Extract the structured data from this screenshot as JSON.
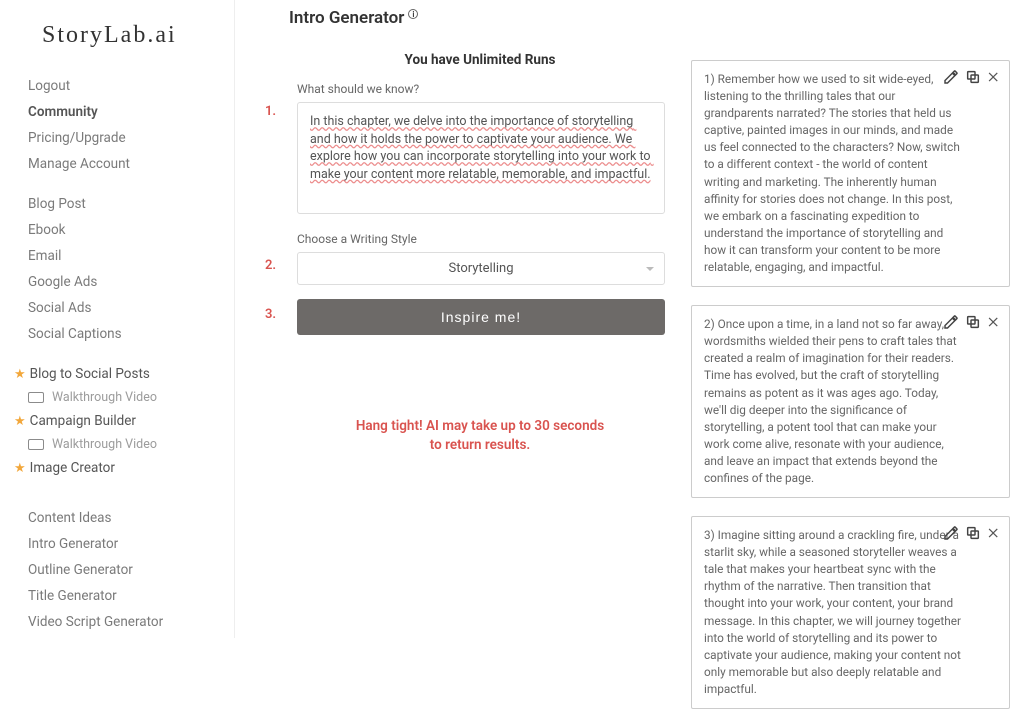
{
  "brand": "StoryLab.ai",
  "sidebar": {
    "account": [
      "Logout",
      "Community",
      "Pricing/Upgrade",
      "Manage Account"
    ],
    "tools1": [
      "Blog Post",
      "Ebook",
      "Email",
      "Google Ads",
      "Social Ads",
      "Social Captions"
    ],
    "featured": [
      {
        "label": "Blog to Social Posts",
        "sub": "Walkthrough Video"
      },
      {
        "label": "Campaign Builder",
        "sub": "Walkthrough Video"
      },
      {
        "label": "Image Creator"
      }
    ],
    "tools2": [
      "Content Ideas",
      "Intro Generator",
      "Outline Generator",
      "Title Generator",
      "Video Script Generator"
    ]
  },
  "page": {
    "title": "Intro Generator",
    "runs_label": "You have Unlimited Runs",
    "steps": [
      "1.",
      "2.",
      "3."
    ],
    "field1_label": "What should we know?",
    "field1_value": "In this chapter, we delve into the importance of storytelling and how it holds the power to captivate your audience. We explore how you can incorporate storytelling into your work to make your content more relatable, memorable, and impactful.",
    "field2_label": "Choose a Writing Style",
    "field2_value": "Storytelling",
    "button_label": "Inspire me!",
    "wait_line1": "Hang tight! AI may take up to 30 seconds",
    "wait_line2": "to return results."
  },
  "results": [
    "1) Remember how we used to sit wide-eyed, listening to the thrilling tales that our grandparents narrated? The stories that held us captive, painted images in our minds, and made us feel connected to the characters? Now, switch to a different context - the world of content writing and marketing. The inherently human affinity for stories does not change. In this post, we embark on a fascinating expedition to understand the importance of storytelling and how it can transform your content to be more relatable, engaging, and impactful.",
    "2) Once upon a time, in a land not so far away, wordsmiths wielded their pens to craft tales that created a realm of imagination for their readers. Time has evolved, but the craft of storytelling remains as potent as it was ages ago. Today, we'll dig deeper into the significance of storytelling, a potent tool that can make your work come alive, resonate with your audience, and leave an impact that extends beyond the confines of the page.",
    "3) Imagine sitting around a crackling fire, under a starlit sky, while a seasoned storyteller weaves a tale that makes your heartbeat sync with the rhythm of the narrative. Then transition that thought into your work, your content, your brand message. In this chapter, we will journey together into the world of storytelling and its power to captivate your audience, making your content not only memorable but also deeply relatable and impactful."
  ]
}
